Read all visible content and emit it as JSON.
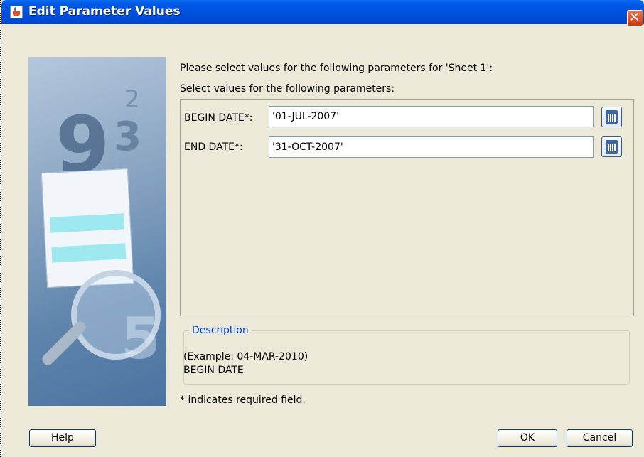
{
  "window": {
    "title": "Edit Parameter Values"
  },
  "prompt": {
    "line1": "Please select values for the following parameters for 'Sheet 1':",
    "line2": "Select values for the following parameters:"
  },
  "params": [
    {
      "label": "BEGIN DATE*:",
      "value": "'01-JUL-2007'",
      "icon": "calendar-icon"
    },
    {
      "label": "END DATE*:",
      "value": "'31-OCT-2007'",
      "icon": "calendar-icon"
    }
  ],
  "description": {
    "legend": "Description",
    "line1": "(Example: 04-MAR-2010)",
    "line2": "BEGIN DATE"
  },
  "note": "* indicates required field.",
  "buttons": {
    "help": "Help",
    "ok": "OK",
    "cancel": "Cancel"
  },
  "colors": {
    "titlebar": "#0054e3",
    "dialog_bg": "#ece9d8",
    "legend_text": "#0046d5"
  }
}
